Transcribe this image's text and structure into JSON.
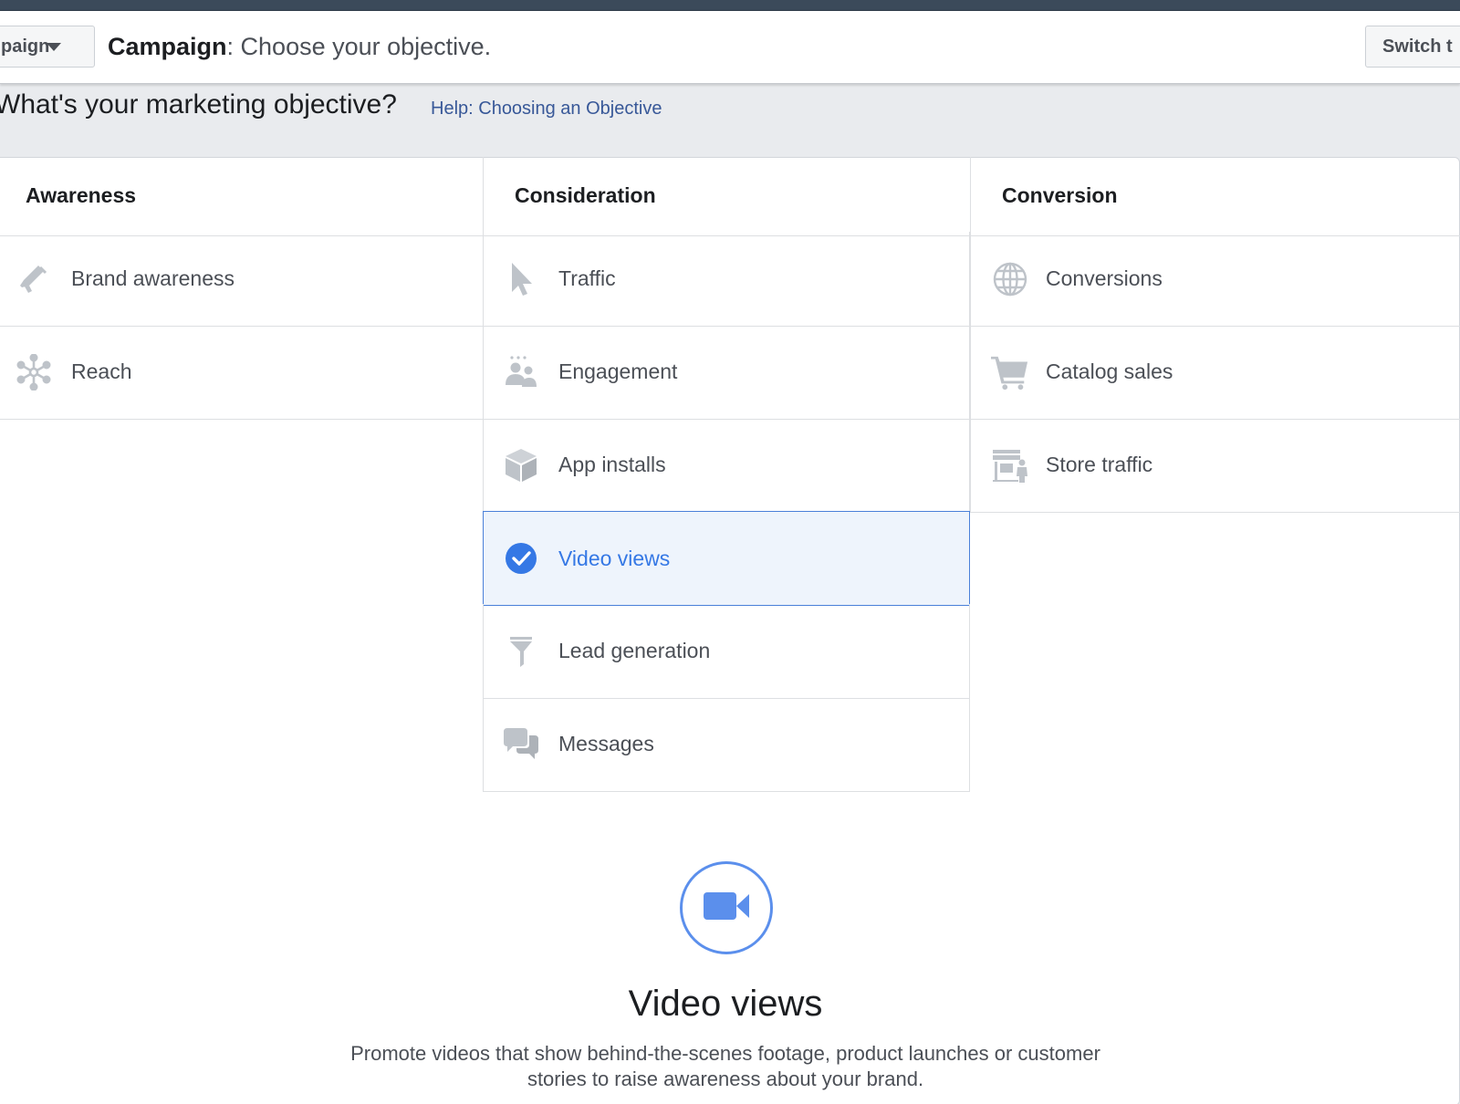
{
  "header": {
    "dropdown_label": "paign",
    "title_bold": "Campaign",
    "title_rest": ": Choose your objective.",
    "switch_label": "Switch t"
  },
  "question": "What's your marketing objective?",
  "help_link": "Help: Choosing an Objective",
  "columns": [
    {
      "heading": "Awareness",
      "items": [
        {
          "label": "Brand awareness",
          "icon": "megaphone-icon"
        },
        {
          "label": "Reach",
          "icon": "reach-icon"
        }
      ]
    },
    {
      "heading": "Consideration",
      "items": [
        {
          "label": "Traffic",
          "icon": "cursor-icon"
        },
        {
          "label": "Engagement",
          "icon": "people-icon"
        },
        {
          "label": "App installs",
          "icon": "box-icon"
        },
        {
          "label": "Video views",
          "icon": "checkmark-icon",
          "selected": true
        },
        {
          "label": "Lead generation",
          "icon": "funnel-icon"
        },
        {
          "label": "Messages",
          "icon": "chat-bubbles-icon"
        }
      ]
    },
    {
      "heading": "Conversion",
      "items": [
        {
          "label": "Conversions",
          "icon": "globe-icon"
        },
        {
          "label": "Catalog sales",
          "icon": "cart-icon"
        },
        {
          "label": "Store traffic",
          "icon": "store-icon"
        }
      ]
    }
  ],
  "detail": {
    "icon": "video-camera-icon",
    "title": "Video views",
    "description": "Promote videos that show behind-the-scenes footage, product launches or customer stories to raise awareness about your brand."
  },
  "colors": {
    "accent": "#3578e5",
    "selected_bg": "#eef4fc",
    "icon_gray": "#bec3c9",
    "link": "#385898"
  }
}
